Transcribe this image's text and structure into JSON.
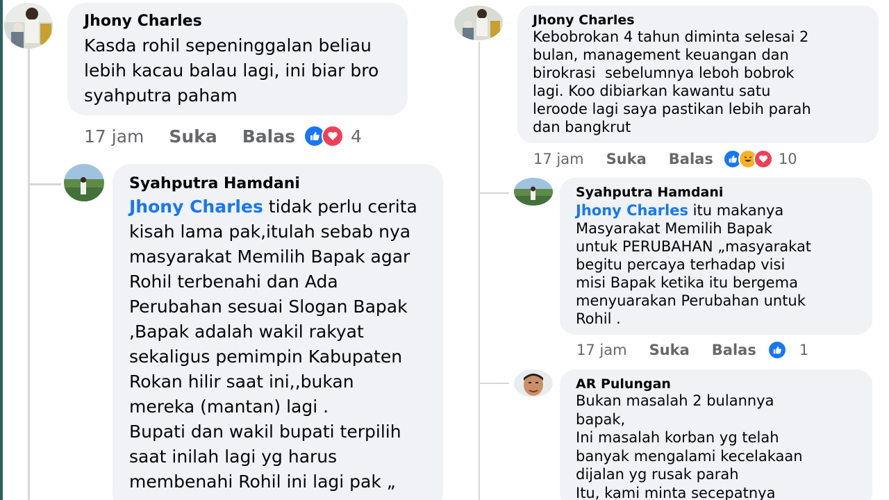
{
  "left": {
    "comment1": {
      "author": "Jhony Charles",
      "text": "Kasda rohil sepeninggalan beliau\nlebih kacau balau lagi, ini biar bro\nsyahputra paham",
      "time": "17 jam",
      "like": "Suka",
      "reply": "Balas",
      "reaction_count": "4",
      "reactions": [
        "like-icon",
        "love-icon"
      ]
    },
    "reply1": {
      "author": "Syahputra Hamdani",
      "tag": "Jhony Charles",
      "text_first": " tidak perlu cerita",
      "text": "kisah lama pak,itulah sebab nya\nmasyarakat Memilih Bapak agar\nRohil terbenahi dan Ada\nPerubahan sesuai Slogan Bapak\n,Bapak adalah wakil rakyat\nsekaligus pemimpin Kabupaten\nRokan hilir saat ini,,bukan\nmereka (mantan) lagi .\nBupati dan wakil bupati terpilih\nsaat inilah lagi yg harus\nmembenahi Rohil ini lagi pak „"
    }
  },
  "right": {
    "comment1": {
      "author": "Jhony Charles",
      "text": "Kebobrokan 4 tahun diminta selesai 2\nbulan, management keuangan dan\nbirokrasi  sebelumnya leboh bobrok\nlagi. Koo dibiarkan kawantu satu\nleroode lagi saya pastikan lebih parah\ndan bangkrut",
      "time": "17 jam",
      "like": "Suka",
      "reply": "Balas",
      "reaction_count": "10",
      "reactions": [
        "like-icon",
        "haha-icon",
        "love-icon"
      ]
    },
    "reply1": {
      "author": "Syahputra Hamdani",
      "tag": "Jhony Charles",
      "text_first": " itu makanya",
      "text": "Masyarakat Memilih Bapak\nuntuk PERUBAHAN „masyarakat\nbegitu percaya terhadap visi\nmisi Bapak ketika itu bergema\nmenyuarakan Perubahan untuk\nRohil .",
      "time": "17 jam",
      "like": "Suka",
      "reply": "Balas",
      "reaction_count": "1",
      "reactions": [
        "like-icon"
      ]
    },
    "reply2": {
      "author": "AR Pulungan",
      "text": "Bukan masalah 2 bulannya\nbapak,\nIni masalah korban yg telah\nbanyak mengalami kecelakaan\ndijalan yg rusak parah\nItu, kami minta secepatnya"
    }
  },
  "colors": {
    "bubble": "#f0f2f5",
    "link": "#1877f2",
    "meta": "#65676b",
    "like": "#1877f2",
    "love": "#f33e58",
    "haha": "#f7b125"
  }
}
